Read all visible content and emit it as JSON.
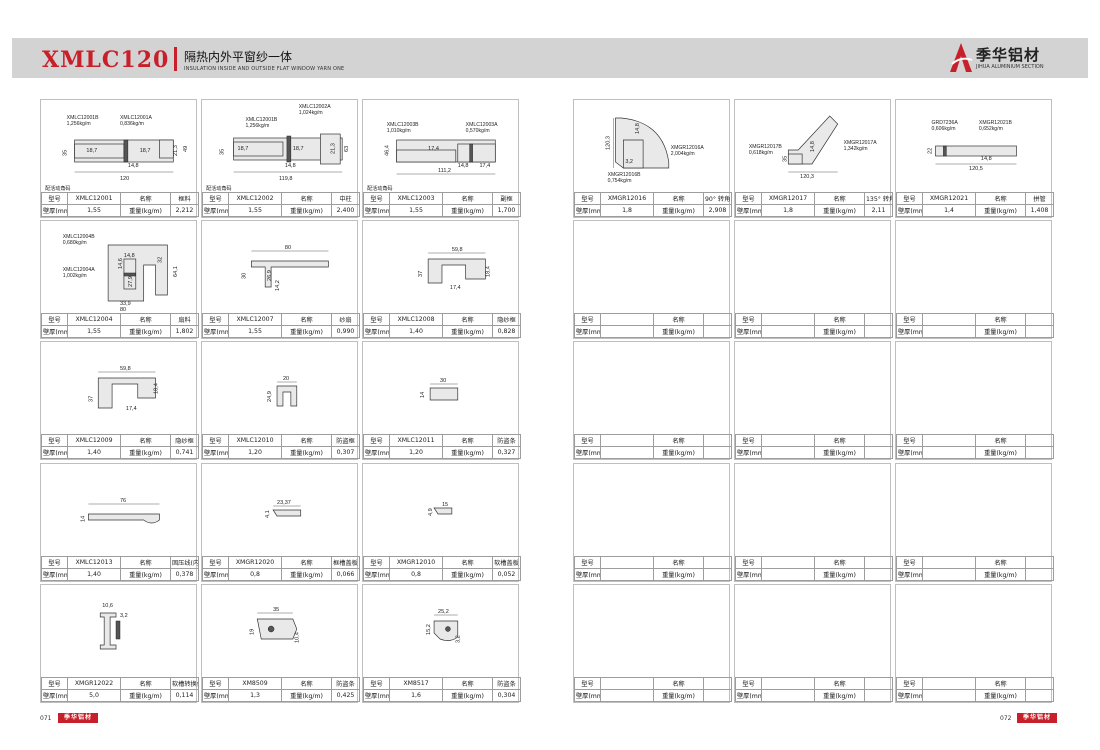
{
  "header": {
    "title": "XMLC120",
    "subtitle_cn": "隔热内外平窗纱一体",
    "subtitle_en": "INSULATION INSIDE AND OUTSIDE FLAT WINDOW YARN ONE",
    "brand_cn": "季华铝材",
    "brand_en": "JIHUA ALUMINIUM SECTION",
    "accent_color": "#c8202a"
  },
  "table_labels": {
    "model": "型号",
    "name": "名称",
    "thickness": "壁厚(mm)",
    "weight": "重量(kg/m)"
  },
  "cards": [
    {
      "model": "XMLC12001",
      "name": "框料",
      "thickness": "1,55",
      "weight": "2,212",
      "labels": [
        "XMLC12001B",
        "1,256kg/m",
        "XMLC12001A",
        "0,836kg/m"
      ],
      "dims": [
        "35",
        "18,7",
        "18,7",
        "21,3",
        "14,8",
        "49",
        "120"
      ],
      "note": "配活动角码"
    },
    {
      "model": "XMLC12002",
      "name": "中柱",
      "thickness": "1,55",
      "weight": "2,400",
      "labels": [
        "XMLC12002A",
        "1,024kg/m",
        "XMLC12001B",
        "1,256kg/m"
      ],
      "dims": [
        "35",
        "18,7",
        "18,7",
        "21,3",
        "14,8",
        "63",
        "119,8"
      ],
      "note": "配活动角码"
    },
    {
      "model": "XMLC12003",
      "name": "副框",
      "thickness": "1,55",
      "weight": "1,700",
      "labels": [
        "XMLC12003B",
        "1,010kg/m",
        "XMLC12003A",
        "0,570kg/m"
      ],
      "dims": [
        "46,4",
        "17,4",
        "14,8",
        "17,4",
        "111,2"
      ],
      "note": "配活动角码"
    },
    {
      "model": "XMGR12016",
      "name": "90° 转角",
      "thickness": "1,8",
      "weight": "2,908",
      "labels": [
        "XMGR12016A",
        "2,004kg/m",
        "XMGR12016B",
        "0,754kg/m"
      ],
      "dims": [
        "120,3",
        "14,8",
        "3,2"
      ],
      "note": ""
    },
    {
      "model": "XMGR12017",
      "name": "135° 转角",
      "thickness": "1,8",
      "weight": "2,11",
      "labels": [
        "XMGR12017B",
        "0,618kg/m",
        "XMGR12017A",
        "1,342kg/m"
      ],
      "dims": [
        "14,8",
        "120,3",
        "35"
      ],
      "note": ""
    },
    {
      "model": "XMGR12021",
      "name": "拼管",
      "thickness": "1,4",
      "weight": "1,408",
      "labels": [
        "GRD7236A",
        "0,606kg/m",
        "XMGR12021B",
        "0,652kg/m"
      ],
      "dims": [
        "22",
        "14,8",
        "120,5"
      ],
      "note": ""
    },
    {
      "model": "XMLC12004",
      "name": "扇料",
      "thickness": "1,55",
      "weight": "1,802",
      "labels": [
        "XMLC12004B",
        "0,680kg/m",
        "XMLC12004A",
        "1,002kg/m"
      ],
      "dims": [
        "14,8",
        "14,6",
        "27,9",
        "32",
        "64,1",
        "33,9",
        "80"
      ],
      "note": ""
    },
    {
      "model": "XMLC12007",
      "name": "纱扇",
      "thickness": "1,55",
      "weight": "0,990",
      "labels": [],
      "dims": [
        "80",
        "30",
        "26,9",
        "14,2"
      ],
      "note": ""
    },
    {
      "model": "XMLC12008",
      "name": "隐纱框",
      "thickness": "1,40",
      "weight": "0,828",
      "labels": [],
      "dims": [
        "59,8",
        "37",
        "18,4",
        "17,4"
      ],
      "note": ""
    },
    {
      "model": "",
      "name": "",
      "thickness": "",
      "weight": "",
      "labels": [],
      "dims": [],
      "note": ""
    },
    {
      "model": "",
      "name": "",
      "thickness": "",
      "weight": "",
      "labels": [],
      "dims": [],
      "note": ""
    },
    {
      "model": "",
      "name": "",
      "thickness": "",
      "weight": "",
      "labels": [],
      "dims": [],
      "note": ""
    },
    {
      "model": "XMLC12009",
      "name": "隐纱框",
      "thickness": "1,40",
      "weight": "0,741",
      "labels": [],
      "dims": [
        "59,8",
        "37",
        "18,4",
        "17,4"
      ],
      "note": ""
    },
    {
      "model": "XMLC12010",
      "name": "防盗框",
      "thickness": "1,20",
      "weight": "0,307",
      "labels": [],
      "dims": [
        "20",
        "24,9"
      ],
      "note": ""
    },
    {
      "model": "XMLC12011",
      "name": "防盗条",
      "thickness": "1,20",
      "weight": "0,327",
      "labels": [],
      "dims": [
        "30",
        "14"
      ],
      "note": ""
    },
    {
      "model": "",
      "name": "",
      "thickness": "",
      "weight": "",
      "labels": [],
      "dims": [],
      "note": ""
    },
    {
      "model": "",
      "name": "",
      "thickness": "",
      "weight": "",
      "labels": [],
      "dims": [],
      "note": ""
    },
    {
      "model": "",
      "name": "",
      "thickness": "",
      "weight": "",
      "labels": [],
      "dims": [],
      "note": ""
    },
    {
      "model": "XMLC12013",
      "name": "固压线(内)",
      "thickness": "1,40",
      "weight": "0,378",
      "labels": [],
      "dims": [
        "76",
        "14"
      ],
      "note": ""
    },
    {
      "model": "XMGR12020",
      "name": "框槽盖板",
      "thickness": "0,8",
      "weight": "0,066",
      "labels": [],
      "dims": [
        "23,37",
        "4,1"
      ],
      "note": ""
    },
    {
      "model": "XMGR12010",
      "name": "软槽盖板",
      "thickness": "0,8",
      "weight": "0,052",
      "labels": [],
      "dims": [
        "4,9",
        "15"
      ],
      "note": ""
    },
    {
      "model": "",
      "name": "",
      "thickness": "",
      "weight": "",
      "labels": [],
      "dims": [],
      "note": ""
    },
    {
      "model": "",
      "name": "",
      "thickness": "",
      "weight": "",
      "labels": [],
      "dims": [],
      "note": ""
    },
    {
      "model": "",
      "name": "",
      "thickness": "",
      "weight": "",
      "labels": [],
      "dims": [],
      "note": ""
    },
    {
      "model": "XMGR12022",
      "name": "软槽转换件",
      "thickness": "5,0",
      "weight": "0,114",
      "labels": [],
      "dims": [
        "10,6",
        "3,2"
      ],
      "note": ""
    },
    {
      "model": "XM8509",
      "name": "防盗条",
      "thickness": "1,3",
      "weight": "0,425",
      "labels": [],
      "dims": [
        "35",
        "19",
        "10,4"
      ],
      "note": ""
    },
    {
      "model": "XM8517",
      "name": "防盗条",
      "thickness": "1,6",
      "weight": "0,304",
      "labels": [],
      "dims": [
        "25,2",
        "15,2",
        "3,2"
      ],
      "note": ""
    },
    {
      "model": "",
      "name": "",
      "thickness": "",
      "weight": "",
      "labels": [],
      "dims": [],
      "note": ""
    },
    {
      "model": "",
      "name": "",
      "thickness": "",
      "weight": "",
      "labels": [],
      "dims": [],
      "note": ""
    },
    {
      "model": "",
      "name": "",
      "thickness": "",
      "weight": "",
      "labels": [],
      "dims": [],
      "note": ""
    }
  ],
  "footer": {
    "page_left": "071",
    "page_right": "072",
    "brand_small": "季华铝材"
  }
}
